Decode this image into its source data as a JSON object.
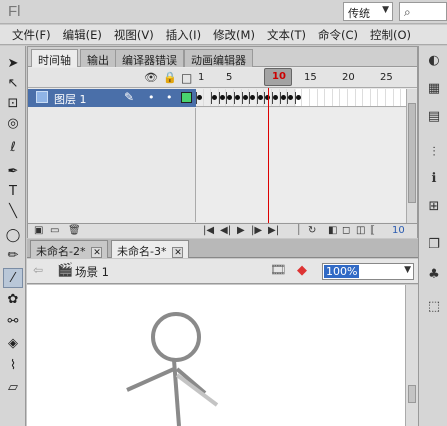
{
  "app": {
    "logo": "Fl",
    "workspace": "传统",
    "workspace_arrow": "▼",
    "search_icon": "⌕"
  },
  "menu": [
    "文件(F)",
    "编辑(E)",
    "视图(V)",
    "插入(I)",
    "修改(M)",
    "文本(T)",
    "命令(C)",
    "控制(O)"
  ],
  "tools_left": [
    {
      "name": "selection-tool-icon",
      "glyph": "➤"
    },
    {
      "name": "subselection-tool-icon",
      "glyph": "↖"
    },
    {
      "name": "free-transform-tool-icon",
      "glyph": "⊡"
    },
    {
      "name": "3d-rotation-tool-icon",
      "glyph": "◎"
    },
    {
      "name": "lasso-tool-icon",
      "glyph": "ℓ"
    },
    {
      "name": "pen-tool-icon",
      "glyph": "✒"
    },
    {
      "name": "text-tool-icon",
      "glyph": "T"
    },
    {
      "name": "line-tool-icon",
      "glyph": "╲"
    },
    {
      "name": "oval-tool-icon",
      "glyph": "◯"
    },
    {
      "name": "pencil-tool-icon",
      "glyph": "✏"
    },
    {
      "name": "brush-tool-icon",
      "glyph": "⁄"
    },
    {
      "name": "deco-tool-icon",
      "glyph": "✿"
    },
    {
      "name": "bone-tool-icon",
      "glyph": "⚯"
    },
    {
      "name": "paint-bucket-tool-icon",
      "glyph": "◈"
    },
    {
      "name": "eyedropper-tool-icon",
      "glyph": "⌇"
    },
    {
      "name": "eraser-tool-icon",
      "glyph": "▱"
    }
  ],
  "tools_right": [
    {
      "name": "color-panel-icon",
      "glyph": "◐"
    },
    {
      "name": "swatches-panel-icon",
      "glyph": "▦"
    },
    {
      "name": "library-panel-icon",
      "glyph": "▤"
    },
    {
      "name": "align-panel-icon",
      "glyph": "⫶"
    },
    {
      "name": "info-panel-icon",
      "glyph": "ℹ"
    },
    {
      "name": "transform-panel-icon",
      "glyph": "⊞"
    },
    {
      "name": "components-panel-icon",
      "glyph": "❐"
    },
    {
      "name": "motion-presets-panel-icon",
      "glyph": "♣"
    },
    {
      "name": "movie-explorer-panel-icon",
      "glyph": "⬚"
    }
  ],
  "timeline": {
    "tabs": [
      "时间轴",
      "输出",
      "编译器错误",
      "动画编辑器"
    ],
    "frame_numbers": [
      "1",
      "5",
      "10",
      "15",
      "20",
      "25"
    ],
    "current_frame": "10",
    "layer": {
      "name": "图层 1"
    },
    "keyframes": [
      1,
      3,
      4,
      5,
      6,
      7,
      8,
      9,
      10,
      11,
      12,
      13,
      14
    ],
    "footer_frame": "10"
  },
  "documents": {
    "tabs": [
      {
        "label": "未命名-2*"
      },
      {
        "label": "未命名-3*"
      }
    ],
    "active": 1
  },
  "editbar": {
    "scene": "场景 1",
    "zoom": "100%"
  },
  "stage": {
    "stroke_color": "#8a8a8a",
    "accent_line_color": "#c4c4c4"
  }
}
